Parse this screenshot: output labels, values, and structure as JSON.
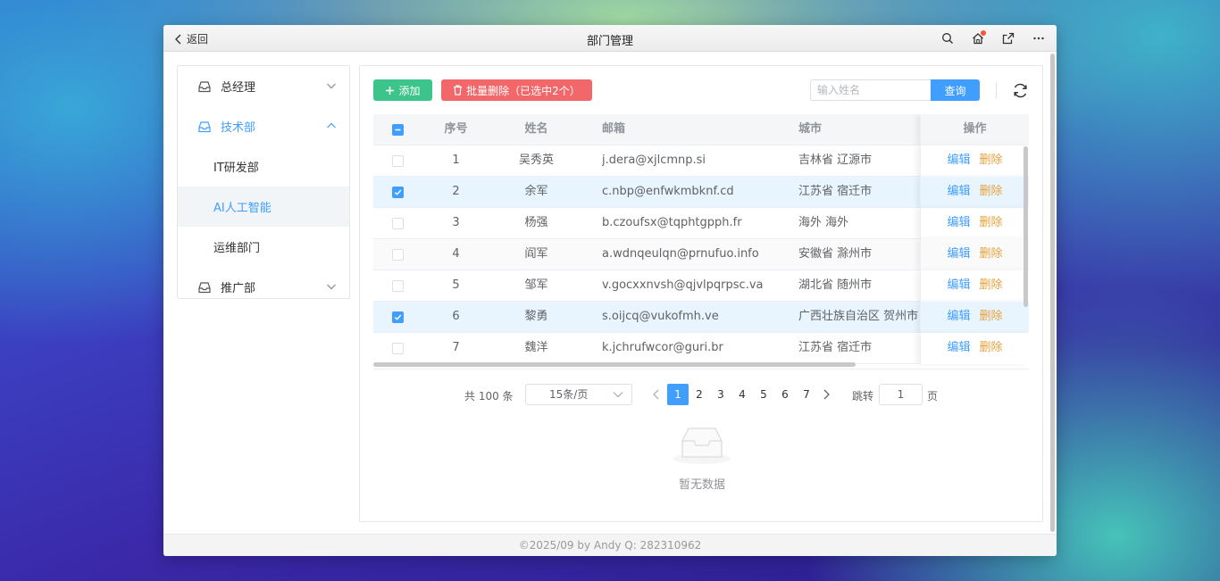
{
  "titlebar": {
    "back_label": "返回",
    "title": "部门管理"
  },
  "sidebar": {
    "groups": [
      {
        "label": "总经理",
        "expanded": false
      },
      {
        "label": "技术部",
        "expanded": true,
        "children": [
          "IT研发部",
          "AI人工智能",
          "运维部门"
        ]
      },
      {
        "label": "推广部",
        "expanded": false
      }
    ],
    "selected": "AI人工智能"
  },
  "toolbar": {
    "add_label": "添加",
    "batch_delete_label": "批量删除（已选中2个）",
    "search_placeholder": "输入姓名",
    "search_button": "查询"
  },
  "table": {
    "columns": {
      "no": "序号",
      "name": "姓名",
      "email": "邮箱",
      "city": "城市",
      "ops": "操作"
    },
    "edit_label": "编辑",
    "delete_label": "删除",
    "rows": [
      {
        "no": "1",
        "name": "吴秀英",
        "email": "j.dera@xjlcmnp.si",
        "city": "吉林省 辽源市",
        "checked": false
      },
      {
        "no": "2",
        "name": "余军",
        "email": "c.nbp@enfwkmbknf.cd",
        "city": "江苏省 宿迁市",
        "checked": true
      },
      {
        "no": "3",
        "name": "杨强",
        "email": "b.czoufsx@tqphtgpph.fr",
        "city": "海外 海外",
        "checked": false
      },
      {
        "no": "4",
        "name": "阎军",
        "email": "a.wdnqeulqn@prnufuo.info",
        "city": "安徽省 滁州市",
        "checked": false
      },
      {
        "no": "5",
        "name": "邹军",
        "email": "v.gocxxnvsh@qjvlpqrpsc.va",
        "city": "湖北省 随州市",
        "checked": false
      },
      {
        "no": "6",
        "name": "黎勇",
        "email": "s.oijcq@vukofmh.ve",
        "city": "广西壮族自治区 贺州市",
        "checked": true
      },
      {
        "no": "7",
        "name": "魏洋",
        "email": "k.jchrufwcor@guri.br",
        "city": "江苏省 宿迁市",
        "checked": false
      }
    ]
  },
  "pagination": {
    "total_label": "共 100 条",
    "page_size": "15条/页",
    "pages": [
      "1",
      "2",
      "3",
      "4",
      "5",
      "6",
      "7"
    ],
    "current": "1",
    "jump_label": "跳转",
    "jump_value": "1",
    "jump_unit": "页"
  },
  "empty_text": "暂无数据",
  "footer": "©2025/09 by Andy Q: 282310962",
  "colors": {
    "primary": "#409eff",
    "success": "#3cc48a",
    "danger": "#f2676a",
    "warning": "#e6a23c"
  },
  "icons": [
    "chevron-left-icon",
    "search-icon",
    "home-icon",
    "open-external-icon",
    "more-icon",
    "inbox-icon",
    "chevron-down-icon",
    "chevron-up-icon",
    "plus-icon",
    "trash-icon",
    "refresh-icon",
    "empty-box-icon"
  ]
}
